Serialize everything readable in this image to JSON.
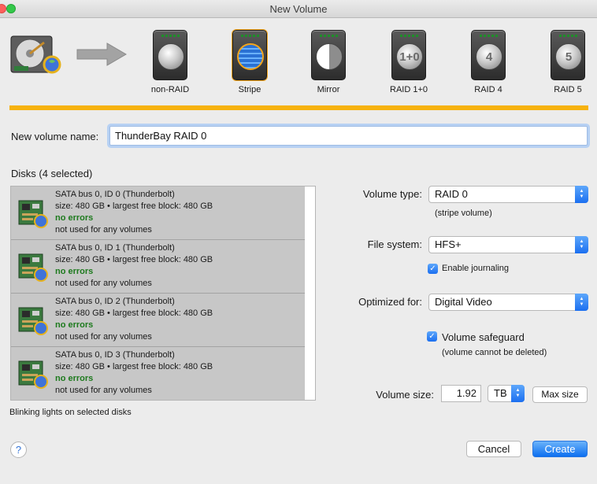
{
  "window": {
    "title": "New Volume"
  },
  "raid_options": [
    {
      "label": "non-RAID",
      "glyph": "",
      "selected": false
    },
    {
      "label": "Stripe",
      "glyph": "",
      "selected": true
    },
    {
      "label": "Mirror",
      "glyph": "",
      "selected": false
    },
    {
      "label": "RAID 1+0",
      "glyph": "1+0",
      "selected": false
    },
    {
      "label": "RAID 4",
      "glyph": "4",
      "selected": false
    },
    {
      "label": "RAID 5",
      "glyph": "5",
      "selected": false
    }
  ],
  "volume_name": {
    "label": "New volume name:",
    "value": "ThunderBay RAID 0"
  },
  "disks": {
    "heading": "Disks (4 selected)",
    "items": [
      {
        "name": "SATA bus 0, ID 0 (Thunderbolt)",
        "size": "size: 480 GB • largest free block: 480 GB",
        "status": "no errors",
        "usage": "not used for any volumes"
      },
      {
        "name": "SATA bus 0, ID 1 (Thunderbolt)",
        "size": "size: 480 GB • largest free block: 480 GB",
        "status": "no errors",
        "usage": "not used for any volumes"
      },
      {
        "name": "SATA bus 0, ID 2 (Thunderbolt)",
        "size": "size: 480 GB • largest free block: 480 GB",
        "status": "no errors",
        "usage": "not used for any volumes"
      },
      {
        "name": "SATA bus 0, ID 3 (Thunderbolt)",
        "size": "size: 480 GB • largest free block: 480 GB",
        "status": "no errors",
        "usage": "not used for any volumes"
      }
    ],
    "blink_note": "Blinking lights on selected disks"
  },
  "volume_type": {
    "label": "Volume type:",
    "value": "RAID 0",
    "note": "(stripe volume)"
  },
  "file_system": {
    "label": "File system:",
    "value": "HFS+",
    "journaling_label": "Enable journaling",
    "journaling_checked": true
  },
  "optimized_for": {
    "label": "Optimized for:",
    "value": "Digital Video"
  },
  "safeguard": {
    "label": "Volume safeguard",
    "note": "(volume cannot be deleted)",
    "checked": true
  },
  "volume_size": {
    "label": "Volume size:",
    "value": "1.92",
    "unit": "TB",
    "max_label": "Max size"
  },
  "buttons": {
    "help": "?",
    "cancel": "Cancel",
    "create": "Create"
  },
  "colors": {
    "accent": "#1b6ff0",
    "selection_bar": "#f6b20f",
    "ok_text": "#1d7a1d"
  }
}
